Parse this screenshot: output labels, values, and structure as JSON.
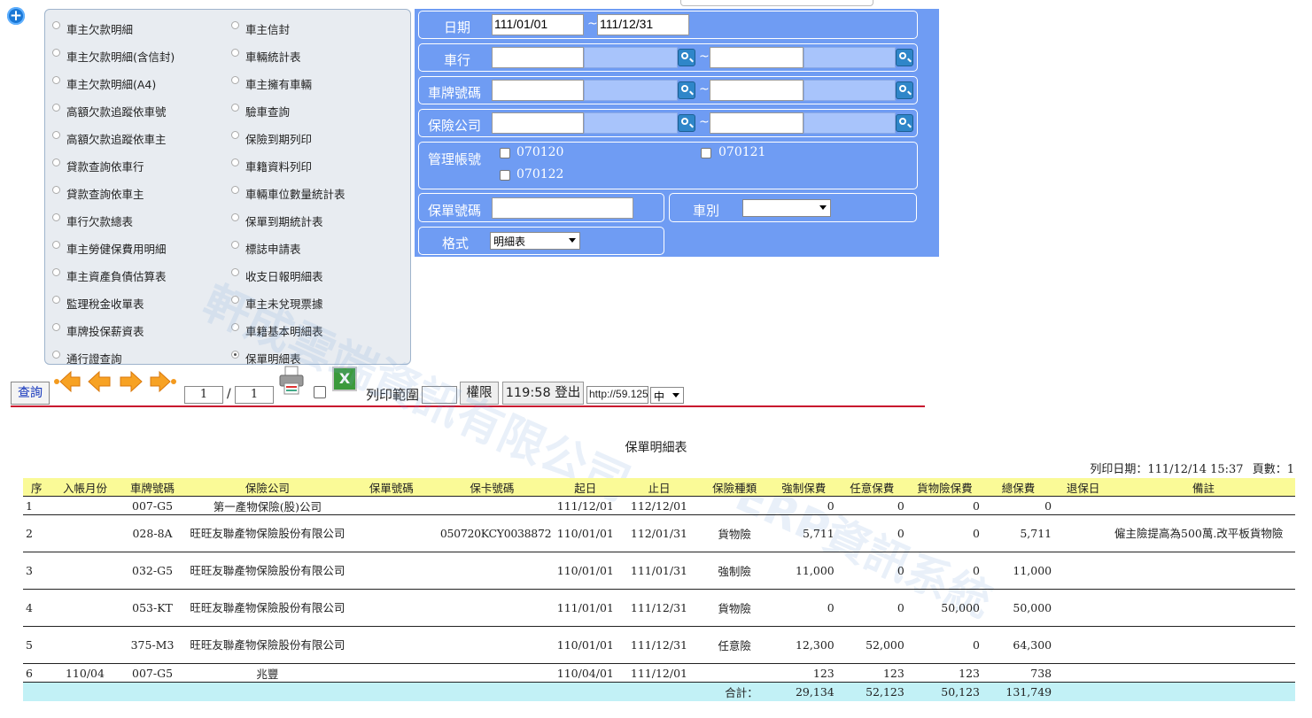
{
  "reports": {
    "left": [
      "車主欠款明細",
      "車主欠款明細(含信封)",
      "車主欠款明細(A4)",
      "高額欠款追蹤依車號",
      "高額欠款追蹤依車主",
      "貸款查詢依車行",
      "貸款查詢依車主",
      "車行欠款總表",
      "車主勞健保費用明細",
      "車主資產負債估算表",
      "監理稅金收單表",
      "車牌投保薪資表",
      "通行證查詢"
    ],
    "right": [
      "車主信封",
      "車輛統計表",
      "車主擁有車輛",
      "驗車查詢",
      "保險到期列印",
      "車籍資料列印",
      "車輛車位數量統計表",
      "保單到期統計表",
      "標誌申請表",
      "收支日報明細表",
      "車主未兌現票據",
      "車籍基本明細表",
      "保單明細表"
    ],
    "selected": "保單明細表"
  },
  "filters": {
    "date_label": "日期",
    "date_from": "111/01/01",
    "date_to": "111/12/31",
    "tilde": "~",
    "company_label": "車行",
    "plate_label": "車牌號碼",
    "insurer_label": "保險公司",
    "account_label": "管理帳號",
    "accounts": [
      "070120",
      "070121",
      "070122"
    ],
    "policy_label": "保單號碼",
    "vehicle_type_label": "車別",
    "format_label": "格式",
    "format_value": "明細表"
  },
  "toolbar": {
    "query_label": "查詢",
    "page_current": "1",
    "page_total": "1",
    "slash": "/",
    "print_range_label": "列印範圍",
    "permission_label": "權限",
    "logout_label": "119:58 登出",
    "url_value": "http://59.125",
    "lang_value": "中"
  },
  "report": {
    "title": "保單明細表",
    "print_date": "列印日期：111/12/14 15:37",
    "page_count": "頁數：1",
    "columns": [
      "序",
      "入帳月份",
      "車牌號碼",
      "保險公司",
      "保單號碼",
      "保卡號碼",
      "起日",
      "止日",
      "保險種類",
      "強制保費",
      "任意保費",
      "貨物險保費",
      "總保費",
      "退保日",
      "備註"
    ],
    "rows": [
      {
        "seq": "1",
        "month": "",
        "plate": "007-G5",
        "insurer": "第一產物保險(股)公司",
        "policy": "",
        "card": "",
        "start": "111/12/01",
        "end": "112/12/01",
        "type": "",
        "compulsory": "0",
        "optional": "0",
        "cargo": "0",
        "total": "0",
        "cancel": "",
        "note": ""
      },
      {
        "seq": "2",
        "month": "",
        "plate": "028-8A",
        "insurer": "旺旺友聯產物保險股份有限公司",
        "policy": "",
        "card": "050720KCY0038872",
        "start": "110/01/01",
        "end": "112/01/31",
        "type": "貨物險",
        "compulsory": "5,711",
        "optional": "0",
        "cargo": "0",
        "total": "5,711",
        "cancel": "",
        "note": "僱主險提高為500萬.改平板貨物險"
      },
      {
        "seq": "3",
        "month": "",
        "plate": "032-G5",
        "insurer": "旺旺友聯產物保險股份有限公司",
        "policy": "",
        "card": "",
        "start": "110/01/01",
        "end": "111/01/31",
        "type": "強制險",
        "compulsory": "11,000",
        "optional": "0",
        "cargo": "0",
        "total": "11,000",
        "cancel": "",
        "note": ""
      },
      {
        "seq": "4",
        "month": "",
        "plate": "053-KT",
        "insurer": "旺旺友聯產物保險股份有限公司",
        "policy": "",
        "card": "",
        "start": "111/01/01",
        "end": "111/12/31",
        "type": "貨物險",
        "compulsory": "0",
        "optional": "0",
        "cargo": "50,000",
        "total": "50,000",
        "cancel": "",
        "note": ""
      },
      {
        "seq": "5",
        "month": "",
        "plate": "375-M3",
        "insurer": "旺旺友聯產物保險股份有限公司",
        "policy": "",
        "card": "",
        "start": "110/01/01",
        "end": "111/12/31",
        "type": "任意險",
        "compulsory": "12,300",
        "optional": "52,000",
        "cargo": "0",
        "total": "64,300",
        "cancel": "",
        "note": ""
      },
      {
        "seq": "6",
        "month": "110/04",
        "plate": "007-G5",
        "insurer": "兆豐",
        "policy": "",
        "card": "",
        "start": "110/04/01",
        "end": "111/12/01",
        "type": "",
        "compulsory": "123",
        "optional": "123",
        "cargo": "123",
        "total": "738",
        "cancel": "",
        "note": ""
      }
    ],
    "totals": {
      "label": "合計：",
      "compulsory": "29,134",
      "optional": "52,123",
      "cargo": "50,123",
      "total": "131,749"
    }
  },
  "watermarks": [
    "軒成雲端資訊有限公司",
    "ERP資訊系統"
  ],
  "colors": {
    "filter_panel": "#6f9cf3",
    "header_row": "#fafa97",
    "total_row": "#c2f1f6",
    "divider": "#c8102e"
  }
}
